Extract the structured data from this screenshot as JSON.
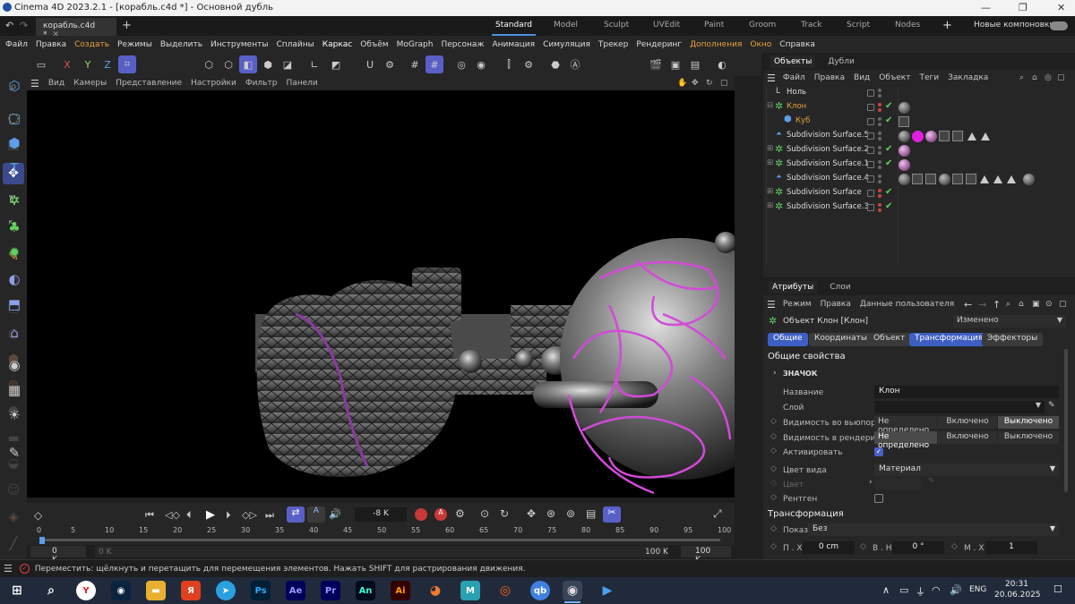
{
  "titlebar": {
    "title": "Cinema 4D 2023.2.1 - [корабль.c4d *] - Основной дубль"
  },
  "tabs": {
    "doc": "корабль.c4d *",
    "layouts": [
      "Standard",
      "Model",
      "Sculpt",
      "UVEdit",
      "Paint",
      "Groom",
      "Track",
      "Script",
      "Nodes"
    ],
    "new_layouts": "Новые компоновки"
  },
  "menu": [
    "Файл",
    "Правка",
    "Создать",
    "Режимы",
    "Выделить",
    "Инструменты",
    "Сплайны",
    "Каркас",
    "Объём",
    "MoGraph",
    "Персонаж",
    "Анимация",
    "Симуляция",
    "Трекер",
    "Рендеринг",
    "Дополнения",
    "Окно",
    "Справка"
  ],
  "toolbar": {
    "x": "X",
    "y": "Y",
    "z": "Z"
  },
  "viewport": {
    "menu": [
      "Вид",
      "Камеры",
      "Представление",
      "Настройки",
      "Фильтр",
      "Панели"
    ]
  },
  "timeline": {
    "frame": "-8 K",
    "start": "0 K",
    "start2": "0 K",
    "end": "100 K",
    "end2": "100 K",
    "ticks": [
      "0",
      "5",
      "10",
      "15",
      "20",
      "25",
      "30",
      "35",
      "40",
      "45",
      "50",
      "55",
      "60",
      "65",
      "70",
      "75",
      "80",
      "85",
      "90",
      "95",
      "100"
    ]
  },
  "objects": {
    "tabs": [
      "Объекты",
      "Дубли"
    ],
    "menu": [
      "Файл",
      "Правка",
      "Вид",
      "Объект",
      "Теги",
      "Закладка"
    ],
    "rows": [
      {
        "name": "Ноль",
        "indent": 0,
        "color": "#dddddd"
      },
      {
        "name": "Клон",
        "indent": 0,
        "color": "#e8a33a"
      },
      {
        "name": "Куб",
        "indent": 1,
        "color": "#e8a33a"
      },
      {
        "name": "Subdivision Surface.5",
        "indent": 0,
        "color": "#dddddd"
      },
      {
        "name": "Subdivision Surface.2",
        "indent": 0,
        "color": "#dddddd"
      },
      {
        "name": "Subdivision Surface.1",
        "indent": 0,
        "color": "#dddddd"
      },
      {
        "name": "Subdivision Surface.4",
        "indent": 0,
        "color": "#dddddd"
      },
      {
        "name": "Subdivision Surface",
        "indent": 0,
        "color": "#dddddd"
      },
      {
        "name": "Subdivision Surface.3",
        "indent": 0,
        "color": "#dddddd"
      }
    ]
  },
  "attributes": {
    "tabs": [
      "Атрибуты",
      "Слои"
    ],
    "menu": [
      "Режим",
      "Правка",
      "Данные пользователя"
    ],
    "object_title": "Объект Клон [Клон]",
    "mode_select": "Изменено",
    "subtabs": [
      "Общие",
      "Координаты",
      "Объект",
      "Трансформация",
      "Эффекторы"
    ],
    "section": "Общие свойства",
    "icon_group": "ЗНАЧОК",
    "name_label": "Название",
    "name_value": "Клон",
    "layer_label": "Слой",
    "vis_viewport_label": "Видимость во вьюпорте",
    "vis_render_label": "Видимость в рендеринге",
    "vis_options": [
      "Не определено",
      "Включено",
      "Выключено"
    ],
    "active_label": "Активировать",
    "view_color_label": "Цвет вида",
    "view_color_value": "Материал",
    "color_label": "Цвет",
    "xray_label": "Рентген",
    "transform_section": "Трансформация",
    "show_label": "Показ",
    "show_value": "Без",
    "px_label": "П . X",
    "px_value": "0 cm",
    "bh_label": "В . Н",
    "bh_value": "0 °",
    "mx_label": "М . X",
    "mx_value": "1"
  },
  "status": "Переместить: щёлкнуть и перетащить для перемещения элементов. Нажать SHIFT для растрирования движения.",
  "taskbar": {
    "lang": "ENG",
    "time": "20:31",
    "date": "20.06.2025"
  }
}
